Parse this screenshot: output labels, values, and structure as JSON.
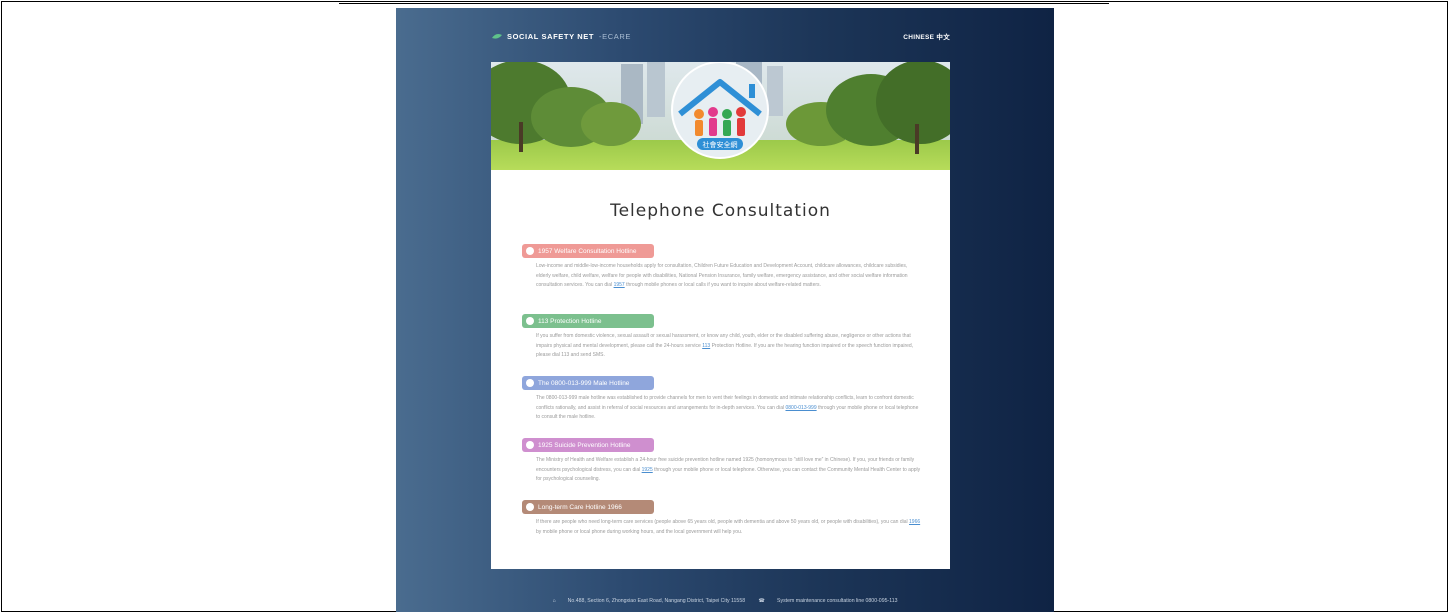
{
  "brand": {
    "name": "SOCIAL SAFETY NET",
    "suffix": "-ECARE"
  },
  "language_link": "CHINESE 中文",
  "logo_text": "社會安全網",
  "page_title": "Telephone Consultation",
  "colors": {
    "pink": "#ef9a96",
    "green": "#7cc08e",
    "blue": "#8fa6dc",
    "purple": "#cf8fcf",
    "brown": "#b48a77",
    "link": "#4a8ed0"
  },
  "sections": [
    {
      "label": "1957 Welfare Consultation Hotline",
      "icon": "heart-icon",
      "color": "pink",
      "pre": "Low-income and middle-low-income households apply for consultation, Children Future Education and Development Account, childcare allowances, childcare subsidies, elderly welfare, child welfare, welfare for people with disabilities, National Pension Insurance, family welfare, emergency assistance, and other social welfare information consultation services. You can dial ",
      "link": "1957",
      "post": " through mobile phones or local calls if you want to inquire about welfare-related matters."
    },
    {
      "label": "113 Protection Hotline",
      "icon": "shield-icon",
      "color": "green",
      "pre": "If you suffer from domestic violence, sexual assault or sexual harassment, or know any child, youth, elder or the disabled suffering abuse, negligence or other actions that impairs physical and mental development, please call the 24-hours service ",
      "link": "113",
      "post": " Protection Hotline. If you are the hearing function impaired or the speech function impaired, please dial 113 and send SMS."
    },
    {
      "label": "The 0800-013-999 Male Hotline",
      "icon": "person-icon",
      "color": "blue",
      "pre": "The 0800-013-999 male hotline was established to provide channels for men to vent their feelings in domestic and intimate relationship conflicts, learn to confront domestic conflicts rationally, and assist in referral of social resources and arrangements for in-depth services. You can dial ",
      "link": "0800-013-999",
      "post": " through your mobile phone or local telephone to consult the male hotline."
    },
    {
      "label": "1925 Suicide Prevention Hotline",
      "icon": "hands-icon",
      "color": "purple",
      "pre": "The Ministry of Health and Welfare establish a 24-hour free suicide prevention hotline named 1925 (homonymous to “still love me” in Chinese). If you, your friends or family encounters psychological distress, you can dial ",
      "link": "1925",
      "post": " through your mobile phone or local telephone. Otherwise, you can contact the Community Mental Health Center to apply for psychological counseling."
    },
    {
      "label": "Long-term Care Hotline 1966",
      "icon": "care-icon",
      "color": "brown",
      "pre": "If there are people who need long-term care services (people above 65 years old, people with dementia and above 50 years old, or people with disabilities), you can dial ",
      "link": "1966",
      "post": " by mobile phone or local phone during working hours, and the local government will help you."
    }
  ],
  "footer": {
    "address": "No.488, Section 6, Zhongxiao East Road, Nangang District, Taipei City 11558",
    "phone": "System maintenance consultation line  0800-095-113"
  }
}
